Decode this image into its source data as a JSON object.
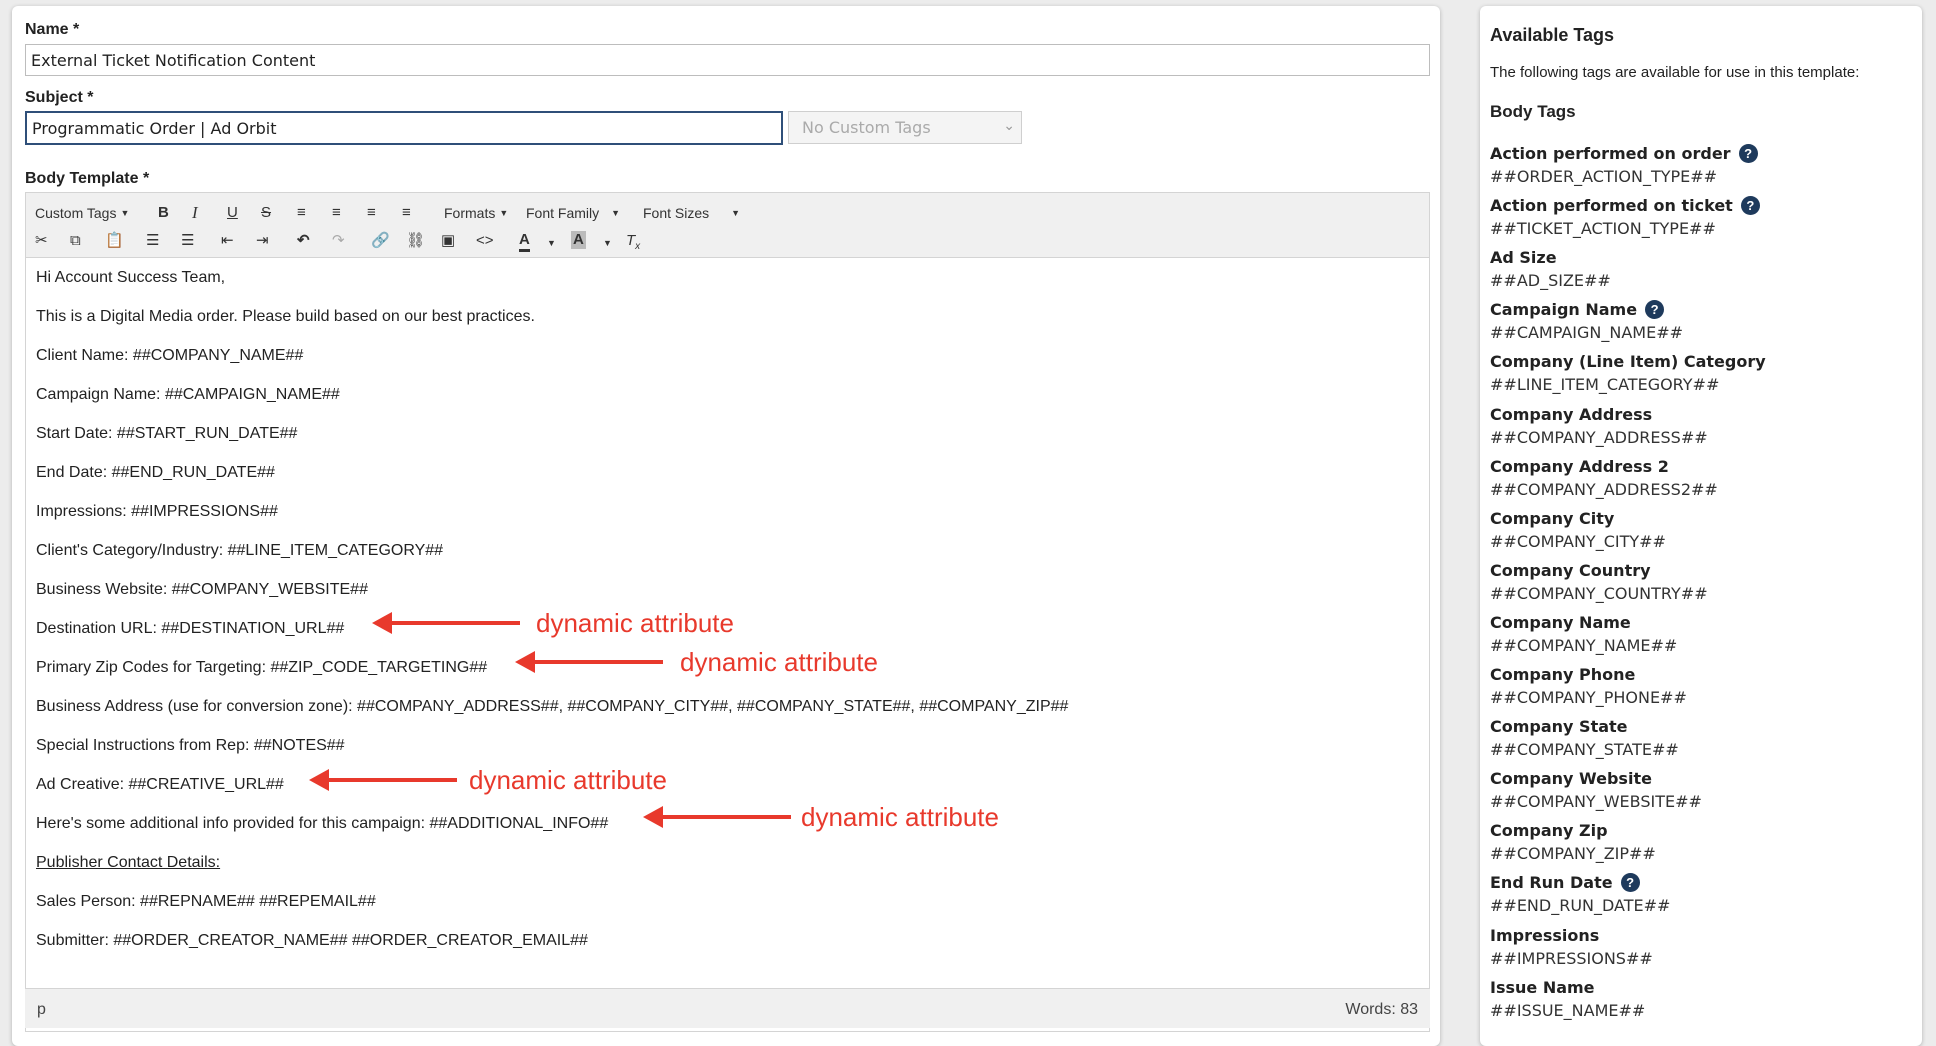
{
  "form": {
    "name_label": "Name *",
    "name_value": "External Ticket Notification Content",
    "subject_label": "Subject *",
    "subject_value": "Programmatic Order | Ad Orbit",
    "custom_tags_select": "No Custom Tags",
    "body_label": "Body Template *"
  },
  "toolbar": {
    "custom_tags": "Custom Tags",
    "formats": "Formats",
    "font_family": "Font Family",
    "font_sizes": "Font Sizes",
    "icons_row1": [
      "bold-icon",
      "italic-icon",
      "underline-icon",
      "strikethrough-icon",
      "align-left-icon",
      "align-center-icon",
      "align-right-icon",
      "align-justify-icon"
    ],
    "icons_row2": [
      "cut-icon",
      "copy-icon",
      "paste-icon",
      "bullet-list-icon",
      "numbered-list-icon",
      "outdent-icon",
      "indent-icon",
      "undo-icon",
      "redo-icon",
      "link-icon",
      "unlink-icon",
      "image-icon",
      "code-icon",
      "text-color-icon",
      "background-color-icon",
      "clear-formatting-icon"
    ]
  },
  "body_lines": [
    "Hi Account Success Team,",
    "This is a Digital Media order. Please build based on our best practices.",
    "Client Name: ##COMPANY_NAME##",
    "Campaign Name: ##CAMPAIGN_NAME##",
    "Start Date: ##START_RUN_DATE##",
    "End Date: ##END_RUN_DATE##",
    "Impressions: ##IMPRESSIONS##",
    "Client's Category/Industry: ##LINE_ITEM_CATEGORY##",
    "Business Website: ##COMPANY_WEBSITE##",
    "Destination URL: ##DESTINATION_URL##",
    "Primary Zip Codes for Targeting: ##ZIP_CODE_TARGETING##",
    "Business Address (use for conversion zone): ##COMPANY_ADDRESS##, ##COMPANY_CITY##, ##COMPANY_STATE##, ##COMPANY_ZIP##",
    "Special Instructions from Rep: ##NOTES##",
    "Ad Creative: ##CREATIVE_URL##",
    "Here's some additional info provided for this campaign: ##ADDITIONAL_INFO##",
    "Publisher Contact Details:",
    "Sales Person: ##REPNAME## ##REPEMAIL##",
    "Submitter: ##ORDER_CREATOR_NAME## ##ORDER_CREATOR_EMAIL##"
  ],
  "annotations": {
    "label": "dynamic attribute",
    "color": "#e8392c"
  },
  "statusbar": {
    "path": "p",
    "words": "Words: 83"
  },
  "tags_panel": {
    "title": "Available Tags",
    "description": "The following tags are available for use in this template:",
    "section": "Body Tags",
    "help_glyph": "?",
    "tags": [
      {
        "name": "Action performed on order",
        "code": "##ORDER_ACTION_TYPE##",
        "help": true
      },
      {
        "name": "Action performed on ticket",
        "code": "##TICKET_ACTION_TYPE##",
        "help": true
      },
      {
        "name": "Ad Size",
        "code": "##AD_SIZE##",
        "help": false
      },
      {
        "name": "Campaign Name",
        "code": "##CAMPAIGN_NAME##",
        "help": true
      },
      {
        "name": "Company (Line Item) Category",
        "code": "##LINE_ITEM_CATEGORY##",
        "help": false
      },
      {
        "name": "Company Address",
        "code": "##COMPANY_ADDRESS##",
        "help": false
      },
      {
        "name": "Company Address 2",
        "code": "##COMPANY_ADDRESS2##",
        "help": false
      },
      {
        "name": "Company City",
        "code": "##COMPANY_CITY##",
        "help": false
      },
      {
        "name": "Company Country",
        "code": "##COMPANY_COUNTRY##",
        "help": false
      },
      {
        "name": "Company Name",
        "code": "##COMPANY_NAME##",
        "help": false
      },
      {
        "name": "Company Phone",
        "code": "##COMPANY_PHONE##",
        "help": false
      },
      {
        "name": "Company State",
        "code": "##COMPANY_STATE##",
        "help": false
      },
      {
        "name": "Company Website",
        "code": "##COMPANY_WEBSITE##",
        "help": false
      },
      {
        "name": "Company Zip",
        "code": "##COMPANY_ZIP##",
        "help": false
      },
      {
        "name": "End Run Date",
        "code": "##END_RUN_DATE##",
        "help": true
      },
      {
        "name": "Impressions",
        "code": "##IMPRESSIONS##",
        "help": false
      },
      {
        "name": "Issue Name",
        "code": "##ISSUE_NAME##",
        "help": false
      }
    ]
  }
}
